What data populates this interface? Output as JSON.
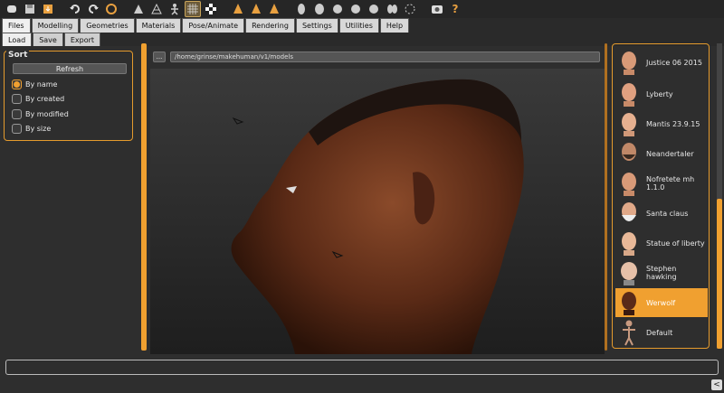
{
  "toolbar": {
    "icons": [
      "new-file-icon",
      "save-icon",
      "export-icon",
      "undo-icon",
      "redo-icon",
      "reset-icon",
      "smooth-icon",
      "wireframe-icon",
      "pose-icon",
      "grid-icon",
      "checker-icon",
      "front-view-icon",
      "side-view-icon",
      "back-view-icon",
      "face-front-icon",
      "face-side-icon",
      "face-3q-icon",
      "face-top-icon",
      "face-left-icon",
      "face-right-icon",
      "camera-fit-icon",
      "screenshot-icon",
      "help-icon"
    ]
  },
  "menu": {
    "tabs": [
      "Files",
      "Modelling",
      "Geometries",
      "Materials",
      "Pose/Animate",
      "Rendering",
      "Settings",
      "Utilities",
      "Help"
    ],
    "active": "Files"
  },
  "submenu": {
    "tabs": [
      "Load",
      "Save",
      "Export"
    ],
    "active": "Load"
  },
  "sort": {
    "title": "Sort",
    "refresh_label": "Refresh",
    "options": [
      "By name",
      "By created",
      "By modified",
      "By size"
    ],
    "selected": "By name"
  },
  "path": {
    "button_label": "...",
    "value": "/home/grinse/makehuman/v1/models"
  },
  "models": [
    {
      "label": "Justice 06 2015"
    },
    {
      "label": "Lyberty"
    },
    {
      "label": "Mantis 23.9.15"
    },
    {
      "label": "Neandertaler"
    },
    {
      "label": "Nofretete mh 1.1.0"
    },
    {
      "label": "Santa claus"
    },
    {
      "label": "Statue of liberty"
    },
    {
      "label": "Stephen hawking"
    },
    {
      "label": "Werwolf"
    },
    {
      "label": "Default"
    }
  ],
  "selected_model": "Werwolf",
  "colors": {
    "accent": "#f0a030",
    "background": "#2e2e2e"
  },
  "status_text": "",
  "scroll_arrow": "<"
}
